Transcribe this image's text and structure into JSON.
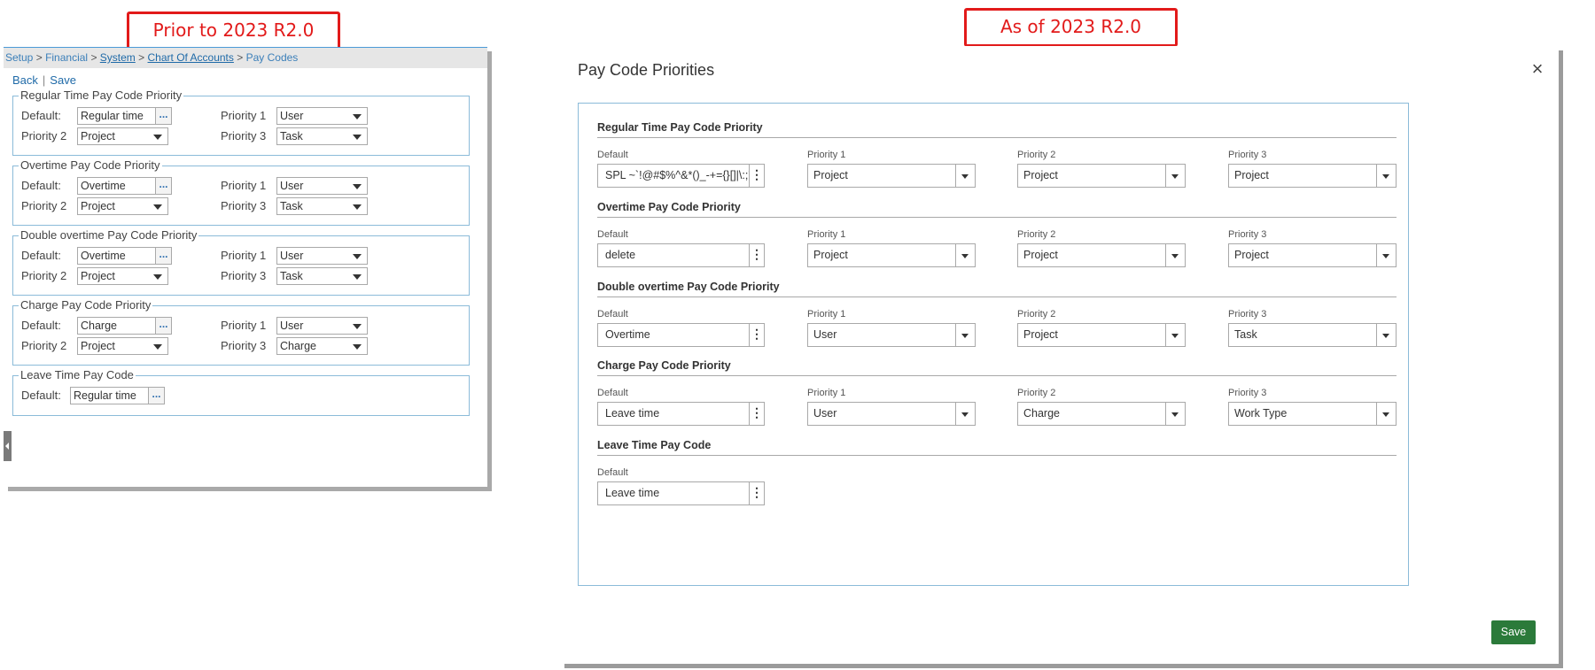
{
  "callouts": {
    "old": "Prior to 2023 R2.0",
    "new": "As of 2023 R2.0"
  },
  "old_ui": {
    "breadcrumb": {
      "setup": "Setup",
      "financial": "Financial",
      "system": "System",
      "chart": "Chart Of Accounts",
      "pay_codes": "Pay Codes",
      "sep": ">"
    },
    "actions": {
      "back": "Back",
      "save": "Save",
      "separator": "|"
    },
    "dots": "...",
    "sections": [
      {
        "title": "Regular Time Pay Code Priority",
        "default_label": "Default:",
        "default_value": "Regular time",
        "p1_label": "Priority 1",
        "p1": "User",
        "p2_label": "Priority 2",
        "p2": "Project",
        "p3_label": "Priority 3",
        "p3": "Task"
      },
      {
        "title": "Overtime Pay Code Priority",
        "default_label": "Default:",
        "default_value": "Overtime",
        "p1_label": "Priority 1",
        "p1": "User",
        "p2_label": "Priority 2",
        "p2": "Project",
        "p3_label": "Priority 3",
        "p3": "Task"
      },
      {
        "title": "Double overtime Pay Code Priority",
        "default_label": "Default:",
        "default_value": "Overtime",
        "p1_label": "Priority 1",
        "p1": "User",
        "p2_label": "Priority 2",
        "p2": "Project",
        "p3_label": "Priority 3",
        "p3": "Task"
      },
      {
        "title": "Charge Pay Code Priority",
        "default_label": "Default:",
        "default_value": "Charge",
        "p1_label": "Priority 1",
        "p1": "User",
        "p2_label": "Priority 2",
        "p2": "Project",
        "p3_label": "Priority 3",
        "p3": "Charge"
      },
      {
        "title": "Leave Time Pay Code",
        "default_label": "Default:",
        "default_value": "Regular time"
      }
    ]
  },
  "new_ui": {
    "title": "Pay Code Priorities",
    "close": "×",
    "save": "Save",
    "more": "⋮",
    "labels": {
      "default": "Default",
      "p1": "Priority 1",
      "p2": "Priority 2",
      "p3": "Priority 3"
    },
    "sections": [
      {
        "title": "Regular Time Pay Code Priority",
        "default": "SPL ~`!@#$%^&*()_-+={}[]|\\:;\"'?/<",
        "p1": "Project",
        "p2": "Project",
        "p3": "Project"
      },
      {
        "title": "Overtime Pay Code Priority",
        "default": "delete",
        "p1": "Project",
        "p2": "Project",
        "p3": "Project"
      },
      {
        "title": "Double overtime Pay Code Priority",
        "default": "Overtime",
        "p1": "User",
        "p2": "Project",
        "p3": "Task"
      },
      {
        "title": "Charge Pay Code Priority",
        "default": "Leave time",
        "p1": "User",
        "p2": "Charge",
        "p3": "Work Type"
      },
      {
        "title": "Leave Time Pay Code",
        "default": "Leave time"
      }
    ]
  }
}
